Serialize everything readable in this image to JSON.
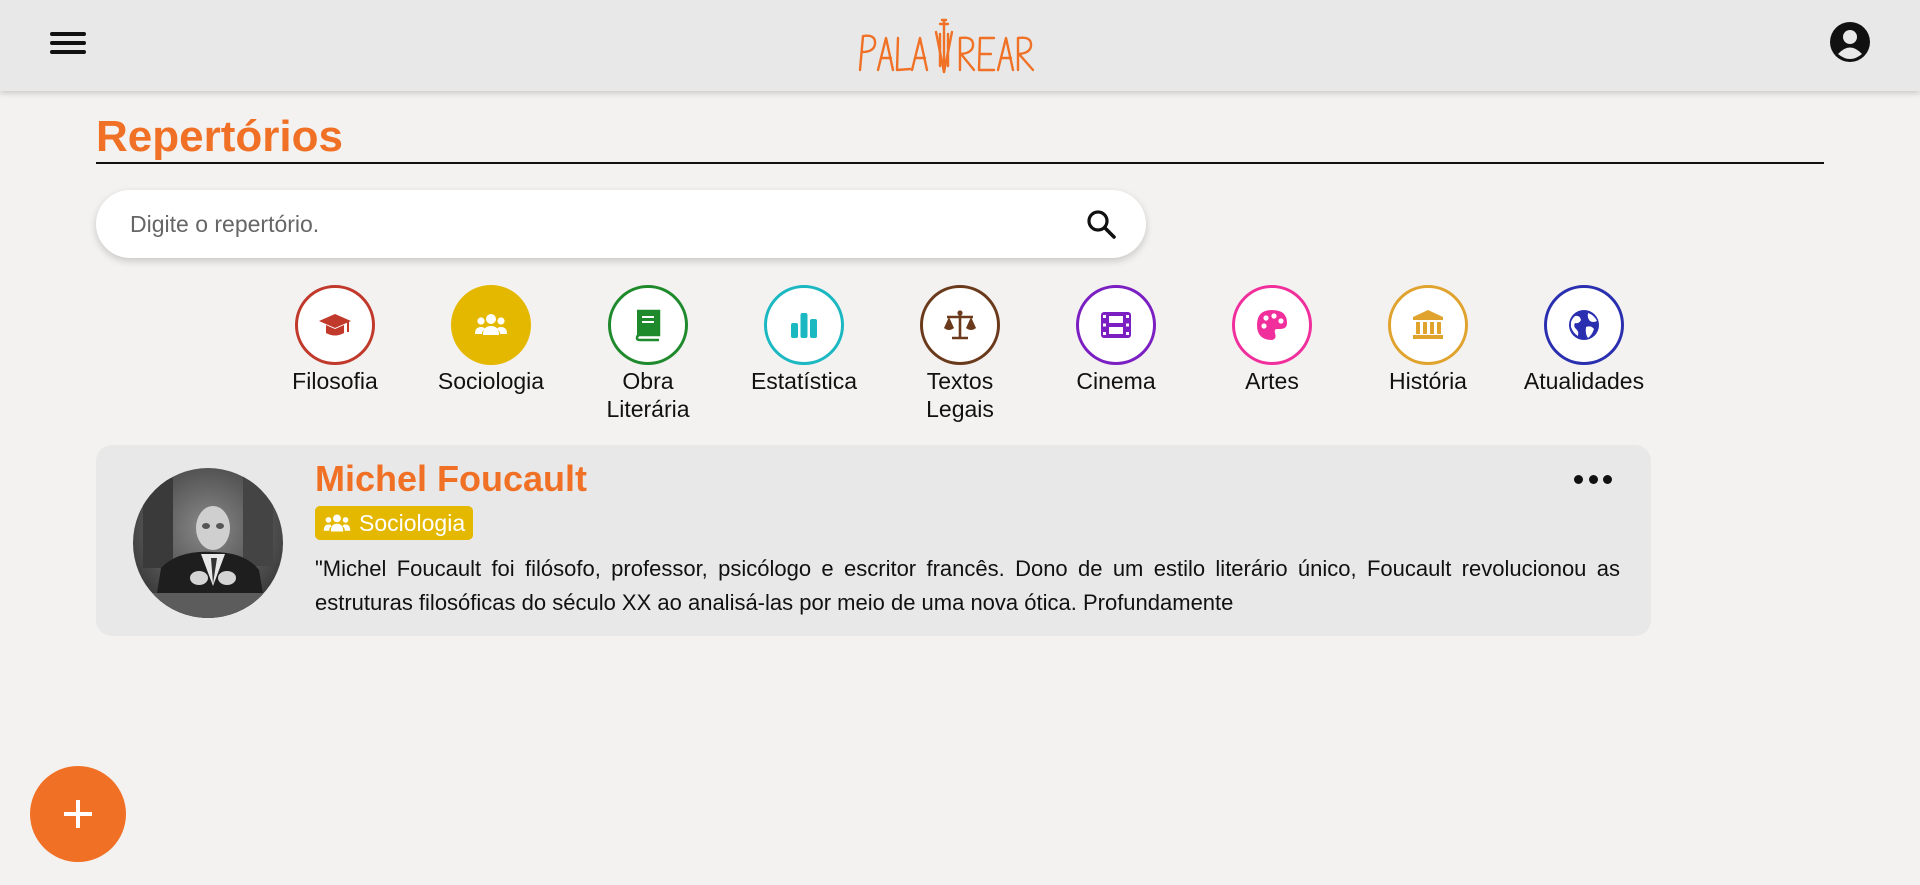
{
  "header": {
    "logo_text": "PALAVREAR"
  },
  "page": {
    "title": "Repertórios"
  },
  "search": {
    "placeholder": "Digite o repertório."
  },
  "categories": [
    {
      "label": "Filosofia",
      "icon": "graduation-cap-icon",
      "color": "#c0392b"
    },
    {
      "label": "Sociologia",
      "icon": "users-icon",
      "color": "#e5b800"
    },
    {
      "label": "Obra Literária",
      "icon": "book-icon",
      "color": "#1e8a2c"
    },
    {
      "label": "Estatística",
      "icon": "bar-chart-icon",
      "color": "#1bb8c2"
    },
    {
      "label": "Textos Legais",
      "icon": "scale-icon",
      "color": "#6b3a1c"
    },
    {
      "label": "Cinema",
      "icon": "film-icon",
      "color": "#7b1fc2"
    },
    {
      "label": "Artes",
      "icon": "palette-icon",
      "color": "#f02f9c"
    },
    {
      "label": "História",
      "icon": "landmark-icon",
      "color": "#e0a32e"
    },
    {
      "label": "Atualidades",
      "icon": "globe-icon",
      "color": "#2a2fb0"
    }
  ],
  "card": {
    "name": "Michel Foucault",
    "category": "Sociologia",
    "category_icon": "users-icon",
    "category_color": "#e5b800",
    "excerpt": "\"Michel Foucault foi filósofo, professor, psicólogo e escritor francês. Dono de um estilo literário único, Foucault revolucionou as estruturas filosóficas do século XX ao analisá-las por meio de uma nova ótica. Profundamente"
  },
  "colors": {
    "accent": "#f07125",
    "background": "#f3f2f1",
    "header": "#e8e8e8",
    "card": "#e8e8e8"
  }
}
